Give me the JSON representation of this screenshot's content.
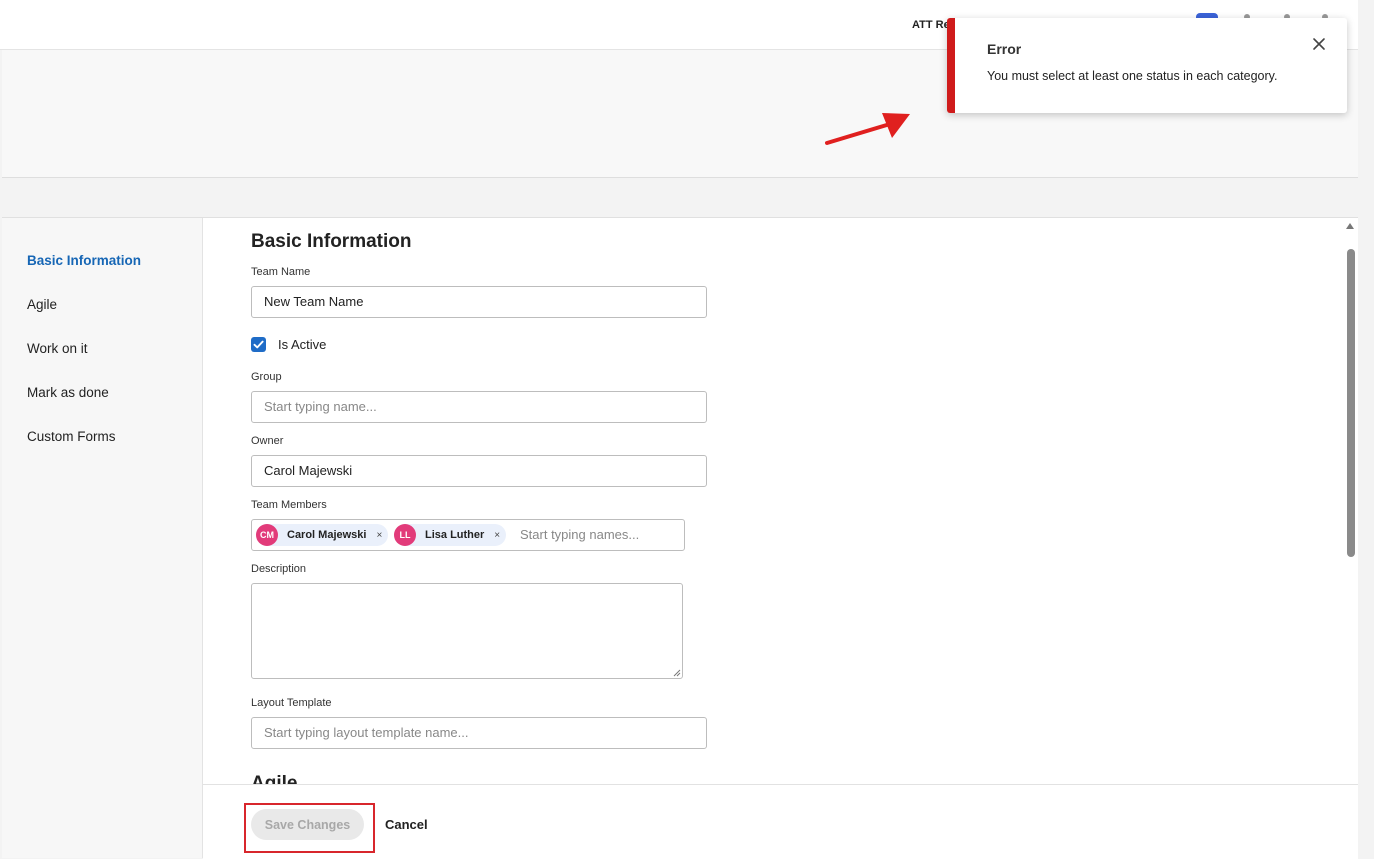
{
  "topbar": {
    "partial_text": "ATT Re"
  },
  "toast": {
    "title": "Error",
    "message": "You must select at least one status in each category."
  },
  "sidebar": {
    "items": [
      {
        "label": "Basic Information"
      },
      {
        "label": "Agile"
      },
      {
        "label": "Work on it"
      },
      {
        "label": "Mark as done"
      },
      {
        "label": "Custom Forms"
      }
    ]
  },
  "form": {
    "section_title": "Basic Information",
    "next_section_title": "Agile",
    "team_name": {
      "label": "Team Name",
      "value": "New Team Name"
    },
    "is_active": {
      "label": "Is Active",
      "checked": true
    },
    "group": {
      "label": "Group",
      "placeholder": "Start typing name..."
    },
    "owner": {
      "label": "Owner",
      "value": "Carol Majewski"
    },
    "team_members": {
      "label": "Team Members",
      "chips": [
        {
          "initials": "CM",
          "name": "Carol Majewski",
          "remove": "×"
        },
        {
          "initials": "LL",
          "name": "Lisa Luther",
          "remove": "×"
        }
      ],
      "placeholder": "Start typing names..."
    },
    "description": {
      "label": "Description",
      "value": ""
    },
    "layout_template": {
      "label": "Layout Template",
      "placeholder": "Start typing layout template name..."
    }
  },
  "footer": {
    "save_label": "Save Changes",
    "cancel_label": "Cancel"
  },
  "colors": {
    "accent": "#1666b5",
    "error": "#cf1b1b",
    "avatar": "#e23b7a",
    "highlight": "#d8262c"
  }
}
